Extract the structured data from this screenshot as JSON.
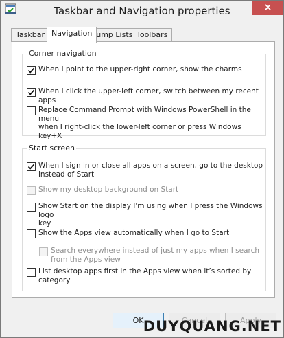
{
  "window": {
    "title": "Taskbar and Navigation properties",
    "close_glyph": "×"
  },
  "tabs": [
    {
      "label": "Taskbar"
    },
    {
      "label": "Navigation"
    },
    {
      "label": "Jump Lists"
    },
    {
      "label": "Toolbars"
    }
  ],
  "corner": {
    "legend": "Corner navigation",
    "options": [
      {
        "label": "When I point to the upper-right corner, show the charms",
        "checked": true
      },
      {
        "label": "When I click the upper-left corner, switch between my recent apps",
        "checked": true
      },
      {
        "label_line1": "Replace Command Prompt with Windows PowerShell in the menu",
        "label_line2": "when I right-click the lower-left corner or press Windows key+X",
        "checked": false
      }
    ]
  },
  "start": {
    "legend": "Start screen",
    "options": [
      {
        "label_line1": "When I sign in or close all apps on a screen, go to the desktop",
        "label_line2": "instead of Start",
        "checked": true
      },
      {
        "label": "Show my desktop background on Start",
        "checked": false,
        "disabled": true
      },
      {
        "label_line1": "Show Start on the display I'm using when I press the Windows logo",
        "label_line2": "key",
        "checked": false
      },
      {
        "label": "Show the Apps view automatically when I go to Start",
        "checked": false
      },
      {
        "label_line1": "Search everywhere instead of just my apps when I search",
        "label_line2": "from the Apps view",
        "checked": false,
        "disabled": true
      },
      {
        "label_line1": "List desktop apps first in the Apps view when it’s sorted by",
        "label_line2": "category",
        "checked": false
      }
    ]
  },
  "buttons": {
    "ok": "OK",
    "cancel": "Cancel",
    "apply": "Apply"
  },
  "watermark": "DUYQUANG.NET",
  "colors": {
    "close_red": "#c75050",
    "ok_accent": "#3c7fb1"
  }
}
